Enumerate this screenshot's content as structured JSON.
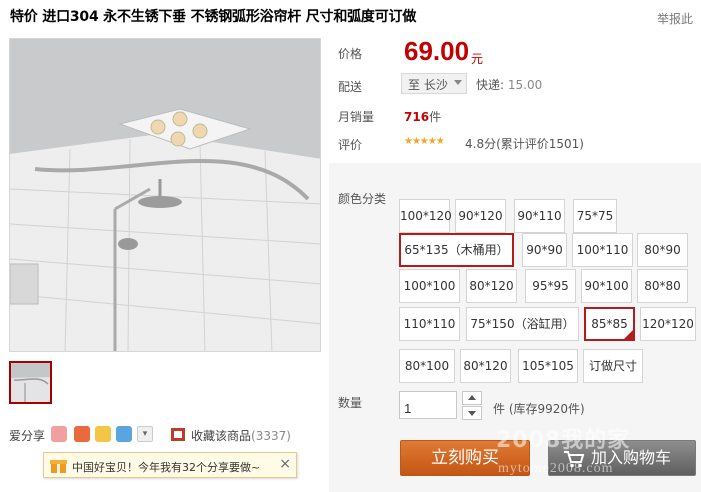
{
  "title": "特价 进口304 永不生锈下垂 不锈钢弧形浴帘杆 尺寸和弧度可订做",
  "report_link": "举报此",
  "price": {
    "label": "价格",
    "value": "69.00",
    "unit": "元"
  },
  "shipping": {
    "label": "配送",
    "destination": "至 长沙",
    "express_label": "快递:",
    "express_fee": "15.00"
  },
  "sales": {
    "label": "月销量",
    "count": "716",
    "unit": "件"
  },
  "rating": {
    "label": "评价",
    "stars": "★★★★★",
    "score_text": "4.8分(累计评价1501)"
  },
  "sku": {
    "label": "颜色分类",
    "selected": "85*85",
    "options": [
      "100*120",
      "90*120",
      "90*110",
      "75*75",
      "65*135（木桶用）",
      "90*90",
      "100*110",
      "80*90",
      "100*100",
      "80*120",
      "95*95",
      "90*100",
      "80*80",
      "110*110",
      "75*150（浴缸用）",
      "85*85",
      "120*120",
      "80*100",
      "80*120",
      "105*105",
      "订做尺寸"
    ]
  },
  "quantity": {
    "label": "数量",
    "value": "1",
    "unit_text": "件 (库存9920件)"
  },
  "buttons": {
    "buy": "立刻购买",
    "cart": "加入购物车"
  },
  "share": {
    "label": "爱分享",
    "favorite": "收藏该商品",
    "favorite_count": "(3337)"
  },
  "promo": {
    "text": "中国好宝贝！今年我有32个分享要做~",
    "close": "×"
  },
  "watermark": {
    "line1": "2008我的家",
    "line2": "mytome2008.com"
  },
  "colors": {
    "price_red": "#c40000",
    "selected_border": "#b41c1c",
    "buy_orange": "#d2661f",
    "cart_gray": "#6f6f6f"
  }
}
